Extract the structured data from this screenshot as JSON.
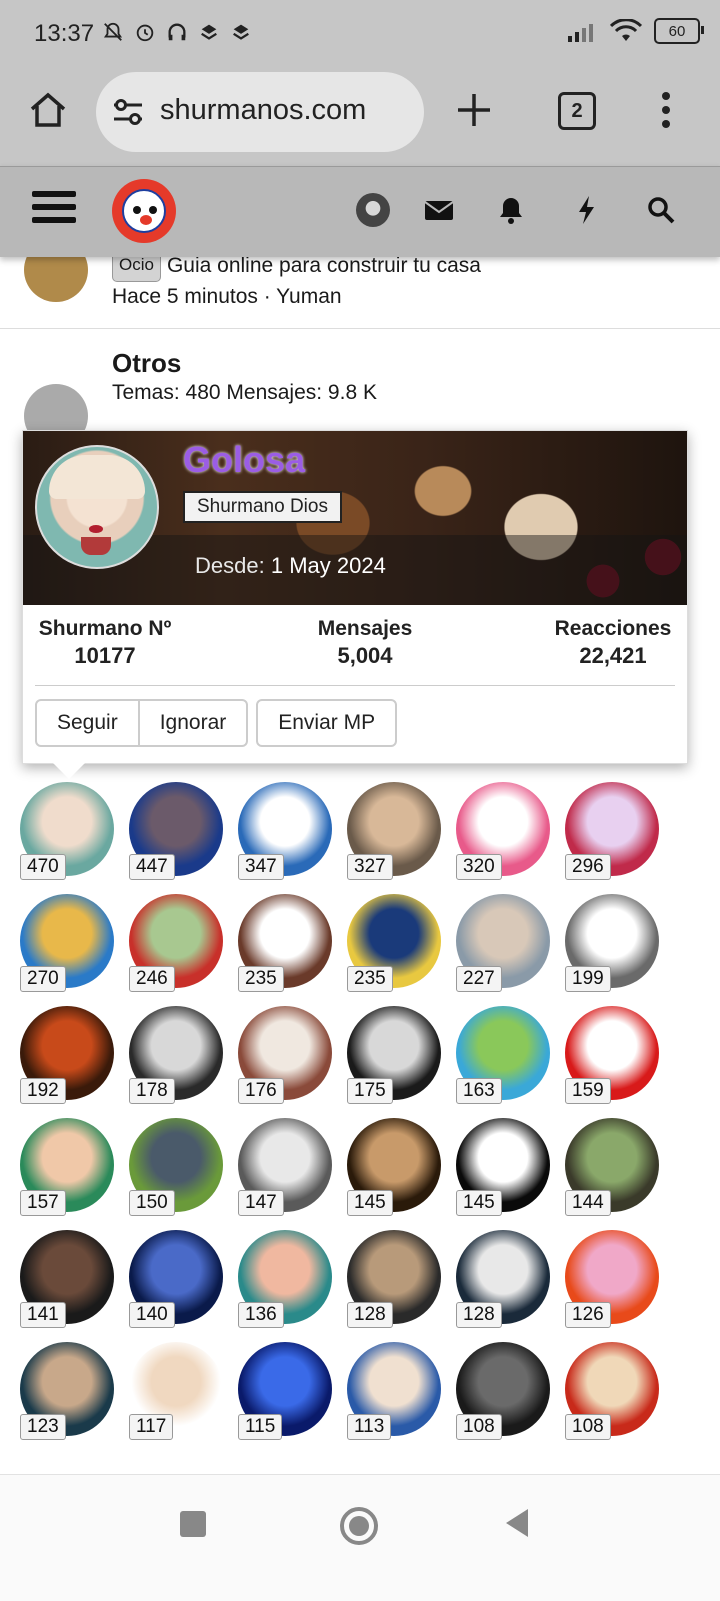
{
  "status_bar": {
    "time": "13:37",
    "battery": "60"
  },
  "browser": {
    "url": "shurmanos.com",
    "tab_count": "2"
  },
  "recent_row": {
    "tag": "Ocio",
    "title": "Guia online para construir tu casa",
    "meta": "Hace 5 minutos · Yuman"
  },
  "otros_row": {
    "title": "Otros",
    "stats": "Temas: 480 Mensajes: 9.8 K"
  },
  "popup": {
    "name": "Golosa",
    "rank": "Shurmano Dios",
    "since_label": "Desde:",
    "since_value": "1 May 2024",
    "stats": [
      {
        "label": "Shurmano Nº",
        "value": "10177"
      },
      {
        "label": "Mensajes",
        "value": "5,004"
      },
      {
        "label": "Reacciones",
        "value": "22,421"
      }
    ],
    "buttons": {
      "follow": "Seguir",
      "ignore": "Ignorar",
      "message": "Enviar MP"
    }
  },
  "user_grid": [
    {
      "count": "470",
      "colors": [
        "#f0dccc",
        "#6aa8a0"
      ]
    },
    {
      "count": "447",
      "colors": [
        "#6b5a6a",
        "#1a3a8a"
      ]
    },
    {
      "count": "347",
      "colors": [
        "#ffffff",
        "#2a6ab8"
      ]
    },
    {
      "count": "327",
      "colors": [
        "#d8b898",
        "#6a5a4a"
      ]
    },
    {
      "count": "320",
      "colors": [
        "#ffffff",
        "#e85a8a"
      ]
    },
    {
      "count": "296",
      "colors": [
        "#e8d0f0",
        "#c02a4a"
      ]
    },
    {
      "count": "270",
      "colors": [
        "#e8b84a",
        "#2a7ac8"
      ]
    },
    {
      "count": "246",
      "colors": [
        "#a8c890",
        "#c8302a"
      ]
    },
    {
      "count": "235",
      "colors": [
        "#ffffff",
        "#6a3a2a"
      ]
    },
    {
      "count": "235",
      "colors": [
        "#1a3a7a",
        "#e8c840"
      ]
    },
    {
      "count": "227",
      "colors": [
        "#d8c8b8",
        "#8a9aa8"
      ]
    },
    {
      "count": "199",
      "colors": [
        "#ffffff",
        "#6a6a6a"
      ]
    },
    {
      "count": "192",
      "colors": [
        "#c84a1a",
        "#3a1a0a"
      ]
    },
    {
      "count": "178",
      "colors": [
        "#d8d8d8",
        "#2a2a2a"
      ]
    },
    {
      "count": "176",
      "colors": [
        "#f0e8e0",
        "#8a4a3a"
      ]
    },
    {
      "count": "175",
      "colors": [
        "#d8d8d8",
        "#1a1a1a"
      ]
    },
    {
      "count": "163",
      "colors": [
        "#8ac85a",
        "#3aa8d8"
      ]
    },
    {
      "count": "159",
      "colors": [
        "#ffffff",
        "#d81a1a"
      ]
    },
    {
      "count": "157",
      "colors": [
        "#f0c8a8",
        "#2a8a5a"
      ]
    },
    {
      "count": "150",
      "colors": [
        "#4a5a6a",
        "#6a9a3a"
      ]
    },
    {
      "count": "147",
      "colors": [
        "#e8e8e8",
        "#5a5a5a"
      ]
    },
    {
      "count": "145",
      "colors": [
        "#c89a6a",
        "#2a1a0a"
      ]
    },
    {
      "count": "145",
      "colors": [
        "#ffffff",
        "#0a0a0a"
      ]
    },
    {
      "count": "144",
      "colors": [
        "#8aa86a",
        "#3a3a2a"
      ]
    },
    {
      "count": "141",
      "colors": [
        "#6a4a3a",
        "#1a1a1a"
      ]
    },
    {
      "count": "140",
      "colors": [
        "#4a6ac8",
        "#0a1a4a"
      ]
    },
    {
      "count": "136",
      "colors": [
        "#f0b8a0",
        "#2a8a8a"
      ]
    },
    {
      "count": "128",
      "colors": [
        "#b89a7a",
        "#2a2a2a"
      ]
    },
    {
      "count": "128",
      "colors": [
        "#e8e8e8",
        "#1a2a3a"
      ]
    },
    {
      "count": "126",
      "colors": [
        "#f0a8c8",
        "#e84a1a"
      ]
    },
    {
      "count": "123",
      "colors": [
        "#c8a88a",
        "#1a3a4a"
      ]
    },
    {
      "count": "117",
      "colors": [
        "#f0d8c0",
        "#ffffff"
      ]
    },
    {
      "count": "115",
      "colors": [
        "#3a6ae8",
        "#0a1a6a"
      ]
    },
    {
      "count": "113",
      "colors": [
        "#f0e0d0",
        "#2a5aa8"
      ]
    },
    {
      "count": "108",
      "colors": [
        "#6a6a6a",
        "#1a1a1a"
      ]
    },
    {
      "count": "108",
      "colors": [
        "#f0d8b8",
        "#c82a1a"
      ]
    }
  ],
  "theme": {
    "popup_name_color": "#9b5de5",
    "chrome_gray": "#c6c6c6",
    "logo_red": "#e53a2a"
  }
}
